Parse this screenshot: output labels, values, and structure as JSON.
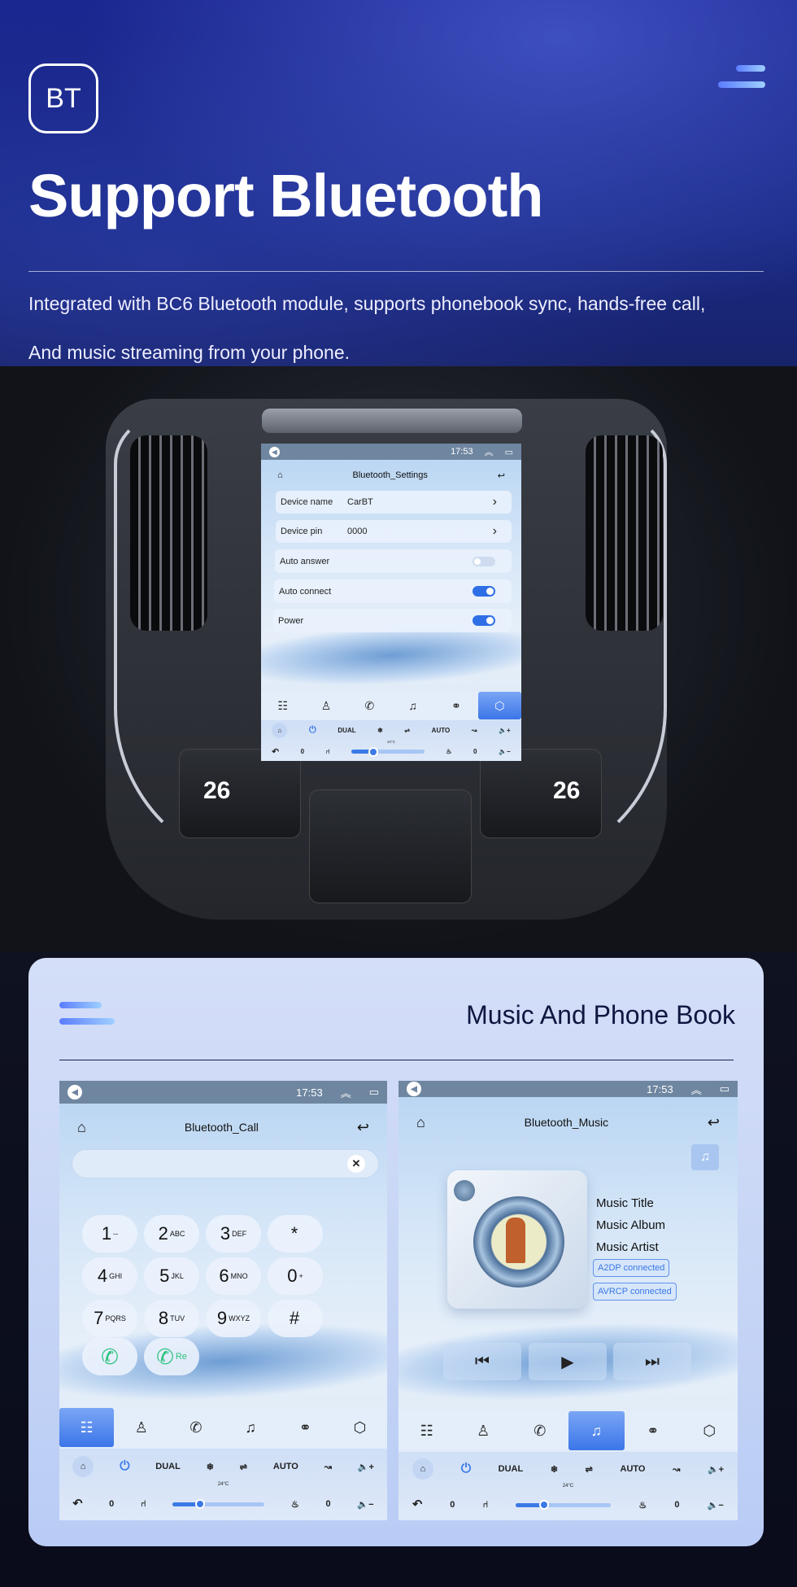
{
  "hero": {
    "badge": "BT",
    "title": "Support Bluetooth",
    "line1": "Integrated with BC6 Bluetooth module, supports phonebook sync, hands-free call,",
    "line2": "And music streaming from your phone."
  },
  "settings_screen": {
    "time": "17:53",
    "title": "Bluetooth_Settings",
    "rows": [
      {
        "label": "Device name",
        "value": "CarBT"
      },
      {
        "label": "Device pin",
        "value": "0000"
      },
      {
        "label": "Auto answer",
        "on": false
      },
      {
        "label": "Auto connect",
        "on": true
      },
      {
        "label": "Power",
        "on": true
      }
    ],
    "active_tab": 5
  },
  "car": {
    "left_temp": "26",
    "right_temp": "26"
  },
  "card": {
    "title": "Music And Phone Book"
  },
  "call_screen": {
    "time": "17:53",
    "title": "Bluetooth_Call",
    "input_value": "",
    "keys": [
      {
        "d": "1",
        "s": "--"
      },
      {
        "d": "2",
        "s": "ABC"
      },
      {
        "d": "3",
        "s": "DEF"
      },
      {
        "d": "*",
        "s": ""
      },
      {
        "d": "4",
        "s": "GHI"
      },
      {
        "d": "5",
        "s": "JKL"
      },
      {
        "d": "6",
        "s": "MNO"
      },
      {
        "d": "0",
        "s": "+"
      },
      {
        "d": "7",
        "s": "PQRS"
      },
      {
        "d": "8",
        "s": "TUV"
      },
      {
        "d": "9",
        "s": "WXYZ"
      },
      {
        "d": "#",
        "s": ""
      }
    ],
    "redial_label": "Re",
    "active_tab": 0
  },
  "music_screen": {
    "time": "17:53",
    "title": "Bluetooth_Music",
    "music_title": "Music Title",
    "music_album": "Music Album",
    "music_artist": "Music Artist",
    "a2dp": "A2DP  connected",
    "avrcp": "AVRCP connected",
    "active_tab": 3
  },
  "climate": {
    "dual": "DUAL",
    "auto": "AUTO",
    "temp": "24°C",
    "left_level": "0",
    "right_level": "0",
    "fan_level_pct": 30
  },
  "nav_icons": [
    "list-icon",
    "contacts-icon",
    "phone-icon",
    "music-icon",
    "link-icon",
    "settings-icon"
  ],
  "colors": {
    "accent": "#3b76e8",
    "call_green": "#2ec27e",
    "status_bar": "#6f86a0"
  }
}
